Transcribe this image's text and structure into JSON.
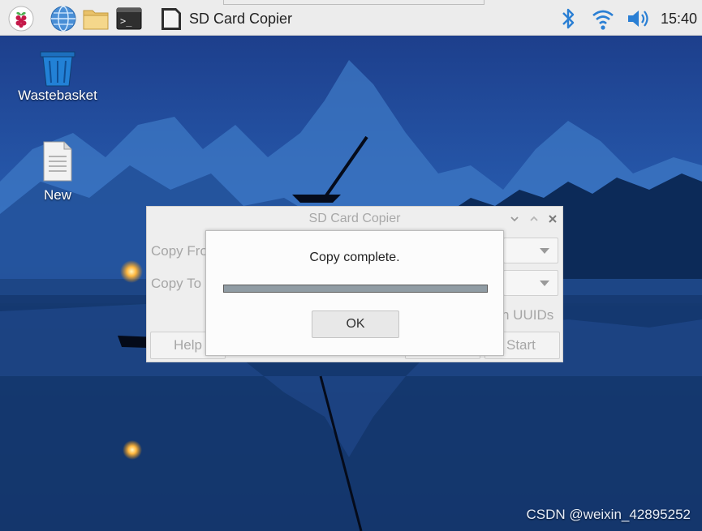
{
  "taskbar": {
    "app_title": "SD Card Copier",
    "clock": "15:40",
    "icons": [
      "raspberry-menu-icon",
      "web-browser-icon",
      "file-manager-icon",
      "terminal-icon",
      "sd-card-icon",
      "bluetooth-icon",
      "wifi-icon",
      "volume-icon"
    ],
    "terminal_glyph": ">_"
  },
  "desktop": {
    "icons": [
      {
        "label": "Wastebasket",
        "icon": "wastebasket-icon"
      },
      {
        "label": "New",
        "icon": "document-icon"
      }
    ],
    "watermark": "CSDN @weixin_42895252"
  },
  "app_window": {
    "title": "SD Card Copier",
    "copy_from_label": "Copy Fro",
    "copy_to_label": "Copy To",
    "uuid_label": "n UUIDs",
    "help_label": "Help",
    "start_label": "Start"
  },
  "dialog": {
    "message": "Copy complete.",
    "progress_percent": 100,
    "ok_label": "OK"
  },
  "colors": {
    "taskbar_bg": "#ececec",
    "accent_blue": "#2a7fd4",
    "progress_fill": "#909ca4"
  }
}
